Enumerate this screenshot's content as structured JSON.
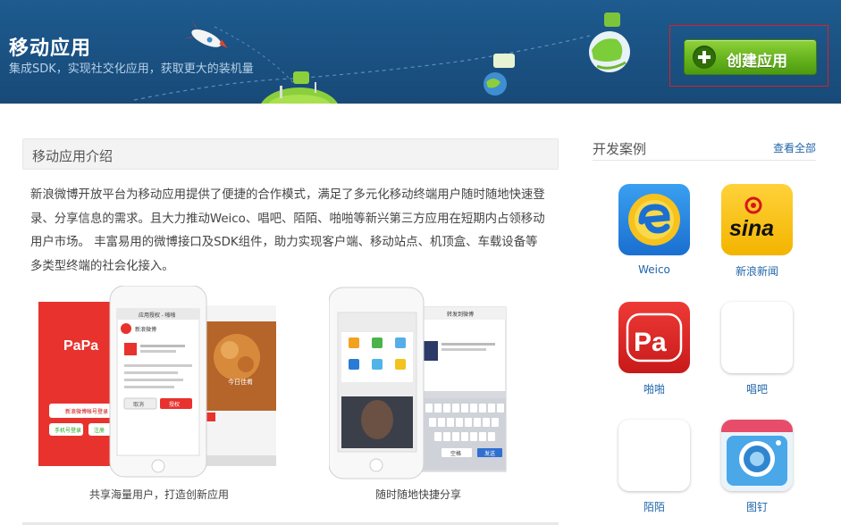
{
  "banner": {
    "title": "移动应用",
    "subtitle": "集成SDK，实现社交化应用，获取更大的装机量",
    "create_button": "创建应用"
  },
  "intro": {
    "heading": "移动应用介绍",
    "body": "新浪微博开放平台为移动应用提供了便捷的合作模式，满足了多元化移动终端用户随时随地快速登录、分享信息的需求。且大力推动Weico、唱吧、陌陌、啪啪等新兴第三方应用在短期内占领移动用户市场。 丰富易用的微博接口及SDK组件，助力实现客户端、移动站点、机顶盒、车载设备等多类型终端的社会化接入。"
  },
  "showcase": [
    {
      "caption": "共享海量用户，打造创新应用",
      "screen_texts": {
        "papa_logo": "PaPa",
        "weibo_login": "新浪微博帐号登录",
        "phone_login": "手机号登录",
        "register": "注册",
        "auth_title": "应用授权 - 啪啪",
        "weibo_brand": "新浪微博",
        "cancel": "取消",
        "authorize": "授权",
        "today": "今日佳肴"
      }
    },
    {
      "caption": "随时随地快捷分享",
      "screen_texts": {
        "share_title": "转发到微博",
        "space": "空格",
        "send": "发送"
      }
    }
  ],
  "cases": {
    "title": "开发案例",
    "more": "查看全部",
    "apps": [
      {
        "name": "Weico",
        "icon": "weico-icon"
      },
      {
        "name": "新浪新闻",
        "icon": "sina-news-icon",
        "icon_text": "sina"
      },
      {
        "name": "啪啪",
        "icon": "papa-icon",
        "icon_text": "Pa"
      },
      {
        "name": "唱吧",
        "icon": "changba-icon"
      },
      {
        "name": "陌陌",
        "icon": "momo-icon"
      },
      {
        "name": "图钉",
        "icon": "tuding-icon"
      }
    ]
  },
  "colors": {
    "banner_bg": "#1a5283",
    "create_green": "#66b31e",
    "link_blue": "#2266aa",
    "papa_red": "#e02020"
  }
}
